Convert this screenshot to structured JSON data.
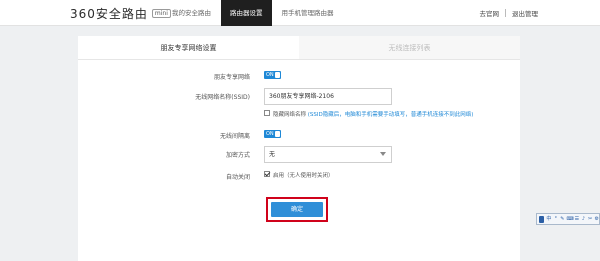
{
  "header": {
    "logo_text": "360安全路由",
    "logo_badge": "mini",
    "nav": [
      "我的安全路由",
      "路由器设置",
      "用手机管理路由器"
    ],
    "links": [
      "去官网",
      "退出管理"
    ]
  },
  "tabs": [
    "朋友专享网络设置",
    "无线连接列表"
  ],
  "form": {
    "status_label": "朋友专享网络",
    "toggle_label": "ON",
    "ssid_label": "无线网络名称(SSID)",
    "ssid_value": "360朋友专享网络-2106",
    "hide_ssid_text": "隐藏网络名称",
    "hide_ssid_hint": "(SSID隐藏后，电脑和手机需要手动填写，普通手机连接不到此网络)",
    "isolation_label": "无线间隔离",
    "encryption_label": "加密方式",
    "encryption_value": "无",
    "auto_off_label": "自动关闭",
    "auto_off_text": "启用（无人使用时关闭）",
    "confirm_label": "确定"
  },
  "ime": {
    "icons": [
      "中",
      "°",
      "✎",
      "⌨",
      "☰",
      "♪",
      "✂",
      "⚙"
    ]
  }
}
